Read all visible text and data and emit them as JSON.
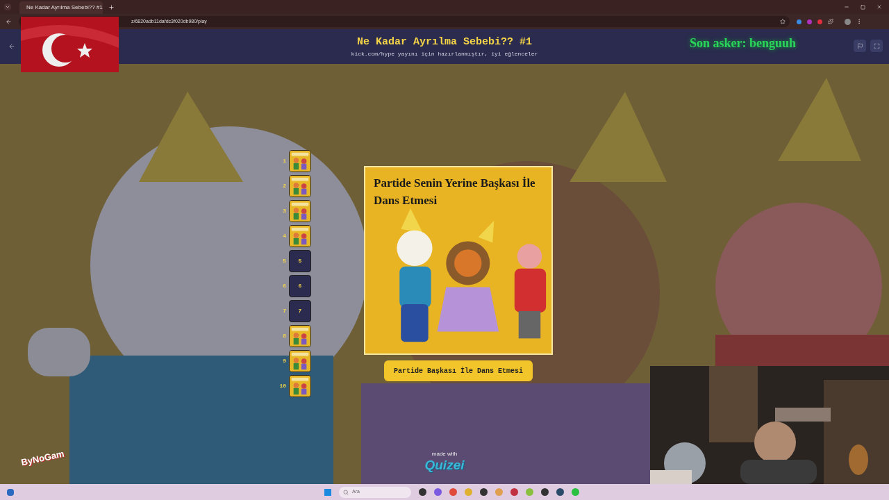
{
  "browser": {
    "tab_title": "Ne Kadar Ayrılma Sebebi?? #1",
    "url": "z/6820adb11dafdc3f020db980/play"
  },
  "header": {
    "title": "Ne Kadar Ayrılma Sebebi?? #1",
    "subtitle": "kick.com/hype yayını için hazırlanmıştır, iyi eğlenceler",
    "last_asker": "Son asker: benguuh"
  },
  "ranking": [
    {
      "rank": "1",
      "filled": true
    },
    {
      "rank": "2",
      "filled": true
    },
    {
      "rank": "3",
      "filled": true
    },
    {
      "rank": "4",
      "filled": true
    },
    {
      "rank": "5",
      "filled": false,
      "slot_label": "5"
    },
    {
      "rank": "6",
      "filled": false,
      "slot_label": "6"
    },
    {
      "rank": "7",
      "filled": false,
      "slot_label": "7"
    },
    {
      "rank": "8",
      "filled": true
    },
    {
      "rank": "9",
      "filled": true
    },
    {
      "rank": "10",
      "filled": true
    }
  ],
  "card": {
    "title": "Partide Senin Yerine Başkası İle Dans Etmesi",
    "answer": "Partide Başkası İle Dans Etmesi"
  },
  "footer": {
    "made_with": "made with",
    "brand": "Quizei"
  },
  "stream_overlay": {
    "logo": "ByNoGam"
  },
  "taskbar": {
    "search_placeholder": "Ara"
  }
}
